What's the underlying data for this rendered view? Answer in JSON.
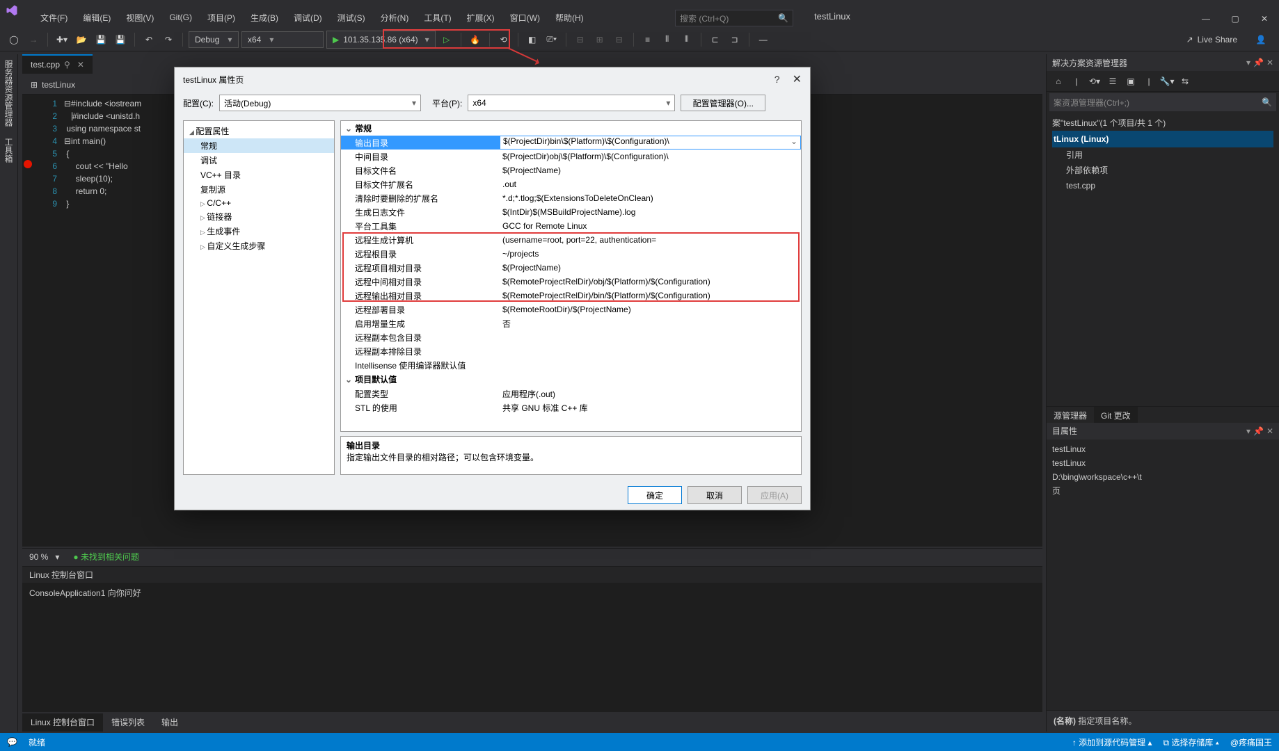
{
  "menubar": [
    "文件(F)",
    "编辑(E)",
    "视图(V)",
    "Git(G)",
    "项目(P)",
    "生成(B)",
    "调试(D)",
    "测试(S)",
    "分析(N)",
    "工具(T)",
    "扩展(X)",
    "窗口(W)",
    "帮助(H)"
  ],
  "search_placeholder": "搜索 (Ctrl+Q)",
  "project_label": "testLinux",
  "toolbar": {
    "config": "Debug",
    "platform": "x64",
    "run": "101.35.135.86 (x64)",
    "liveshare": "Live Share"
  },
  "leftrail": [
    "服务器资源管理器",
    "工具箱"
  ],
  "tab": {
    "name": "test.cpp"
  },
  "proj_header": "testLinux",
  "gutter": [
    "1",
    "2",
    "3",
    "4",
    "5",
    "6",
    "7",
    "8",
    "9"
  ],
  "code": [
    "⊟#include <iostream",
    "⎹#include <unistd.h",
    " using namespace st",
    "⊟int main()",
    " {",
    "     cout << \"Hello",
    "     sleep(10);",
    "     return 0;",
    " }"
  ],
  "zoom": {
    "pct": "90 %",
    "msg": "未找到相关问题"
  },
  "console_hdr": "Linux 控制台窗口",
  "console_line": "ConsoleApplication1 向你问好",
  "btm_tabs": [
    "Linux 控制台窗口",
    "错误列表",
    "输出"
  ],
  "status": {
    "ready": "就绪",
    "add": "↑ 添加到源代码管理 ▴",
    "repo": "⧉ 选择存储库 ▴",
    "user": "@疼痛国王"
  },
  "right": {
    "hdr": "解决方案资源管理器",
    "search": "案资源管理器(Ctrl+;)",
    "sln": "案\"testLinux\"(1 个项目/共 1 个)",
    "prj": "tLinux (Linux)",
    "items": [
      "引用",
      "外部依赖项",
      "test.cpp"
    ],
    "tab1": "源管理器",
    "tab2": "Git 更改",
    "prop_hdr": "目属性",
    "p1": "testLinux",
    "p2": "testLinux",
    "p3": "D:\\bing\\workspace\\c++\\t",
    "p4": "页",
    "name_hdr": "(名称)",
    "name_desc": "指定项目名称。"
  },
  "dialog": {
    "title": "testLinux 属性页",
    "cfg_label": "配置(C):",
    "cfg_value": "活动(Debug)",
    "plt_label": "平台(P):",
    "plt_value": "x64",
    "mgr": "配置管理器(O)...",
    "tree": {
      "root": "配置属性",
      "items": [
        "常规",
        "调试",
        "VC++ 目录",
        "复制源",
        "C/C++",
        "链接器",
        "生成事件",
        "自定义生成步骤"
      ]
    },
    "cat1": "常规",
    "rows": [
      {
        "k": "输出目录",
        "v": "$(ProjectDir)bin\\$(Platform)\\$(Configuration)\\",
        "sel": true
      },
      {
        "k": "中间目录",
        "v": "$(ProjectDir)obj\\$(Platform)\\$(Configuration)\\"
      },
      {
        "k": "目标文件名",
        "v": "$(ProjectName)"
      },
      {
        "k": "目标文件扩展名",
        "v": ".out"
      },
      {
        "k": "清除时要删除的扩展名",
        "v": "*.d;*.tlog;$(ExtensionsToDeleteOnClean)"
      },
      {
        "k": "生成日志文件",
        "v": "$(IntDir)$(MSBuildProjectName).log"
      },
      {
        "k": "平台工具集",
        "v": "GCC for Remote Linux"
      },
      {
        "k": "远程生成计算机",
        "v": "                     (username=root, port=22, authentication="
      },
      {
        "k": "远程根目录",
        "v": "~/projects"
      },
      {
        "k": "远程项目相对目录",
        "v": "$(ProjectName)"
      },
      {
        "k": "远程中间相对目录",
        "v": "$(RemoteProjectRelDir)/obj/$(Platform)/$(Configuration)"
      },
      {
        "k": "远程输出相对目录",
        "v": "$(RemoteProjectRelDir)/bin/$(Platform)/$(Configuration)"
      },
      {
        "k": "远程部署目录",
        "v": "$(RemoteRootDir)/$(ProjectName)"
      },
      {
        "k": "启用增量生成",
        "v": "否"
      },
      {
        "k": "远程副本包含目录",
        "v": ""
      },
      {
        "k": "远程副本排除目录",
        "v": ""
      },
      {
        "k": "Intellisense 使用编译器默认值",
        "v": ""
      }
    ],
    "cat2": "项目默认值",
    "rows2": [
      {
        "k": "配置类型",
        "v": "应用程序(.out)"
      },
      {
        "k": "STL 的使用",
        "v": "共享 GNU 标准 C++ 库"
      }
    ],
    "desc_t": "输出目录",
    "desc_b": "指定输出文件目录的相对路径；可以包含环境变量。",
    "ok": "确定",
    "cancel": "取消",
    "apply": "应用(A)"
  }
}
